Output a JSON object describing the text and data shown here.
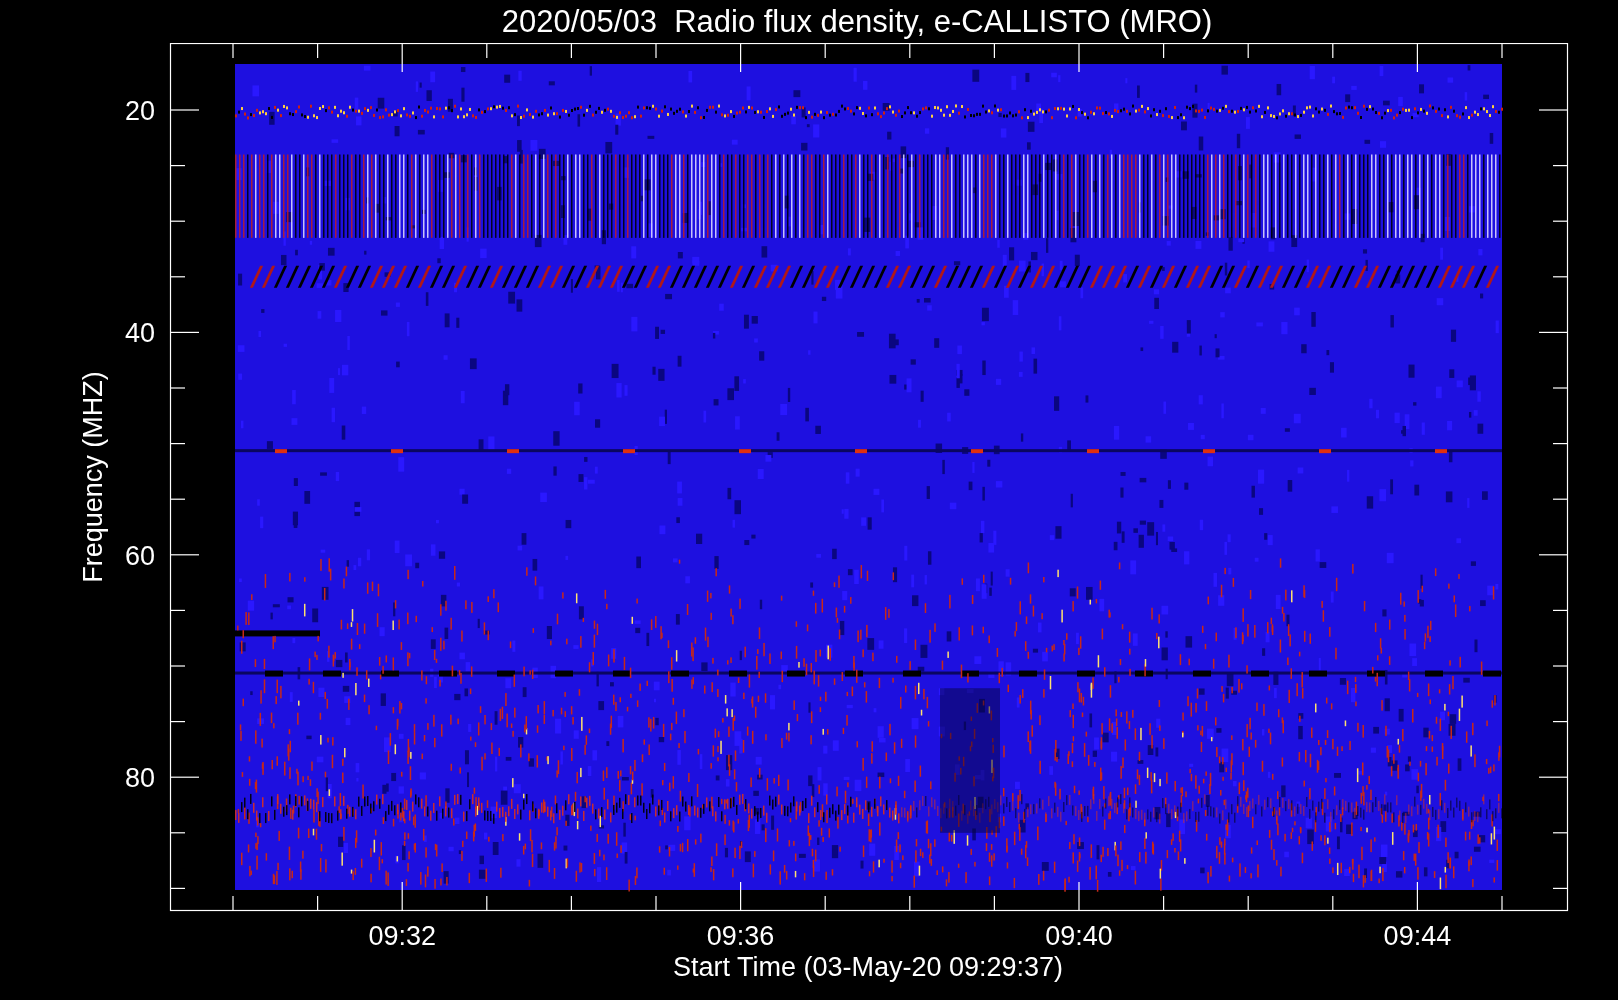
{
  "title": "2020/05/03  Radio flux density, e-CALLISTO (MRO)",
  "y_axis": {
    "label": "Frequency (MHZ)",
    "ticks": [
      "20",
      "40",
      "60",
      "80"
    ]
  },
  "x_axis": {
    "label": "Start Time (03-May-20 09:29:37)",
    "ticks": [
      "09:32",
      "09:36",
      "09:40",
      "09:44"
    ]
  }
}
